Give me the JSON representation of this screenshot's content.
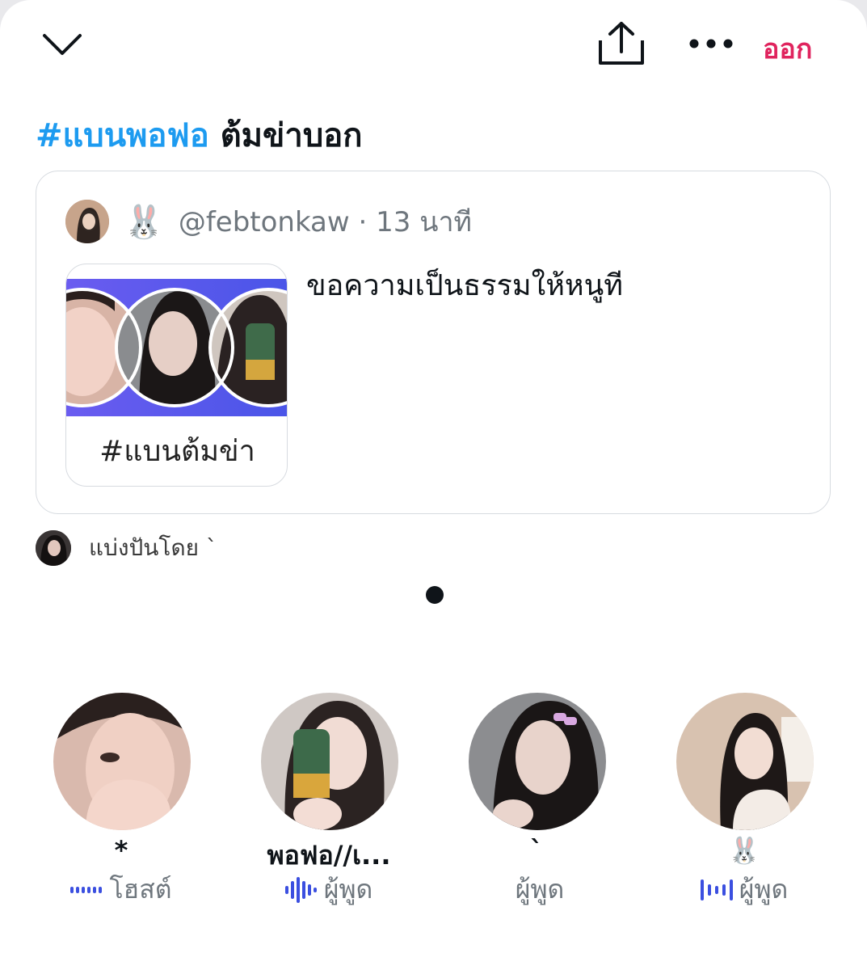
{
  "header": {
    "leave_label": "ออก"
  },
  "space": {
    "title_hashtag": "#แบนพอฟอ",
    "title_rest": " ต้มข่าบอก"
  },
  "quoted_tweet": {
    "emoji": "🐰",
    "handle": "@febtonkaw",
    "separator": " · ",
    "time": "13 นาที",
    "text": "ขอความเป็นธรรมให้หนูที",
    "image_caption": "#แบนต้มข่า"
  },
  "shared_by": {
    "label": "แบ่งปันโดย `"
  },
  "participants": [
    {
      "name": "*",
      "role": "โฮสต์"
    },
    {
      "name": "พอฟอ//เ...",
      "role": "ผู้พูด"
    },
    {
      "name": "`",
      "role": "ผู้พูด"
    },
    {
      "name": "🐰",
      "role": "ผู้พูด"
    }
  ],
  "colors": {
    "accent": "#1d9bf0",
    "leave": "#e0245e",
    "speaking": "#3b4fe0",
    "muted_text": "#6e767d"
  },
  "icons": [
    "chevron-down-icon",
    "share-icon",
    "more-icon",
    "audio-wave-icon"
  ]
}
